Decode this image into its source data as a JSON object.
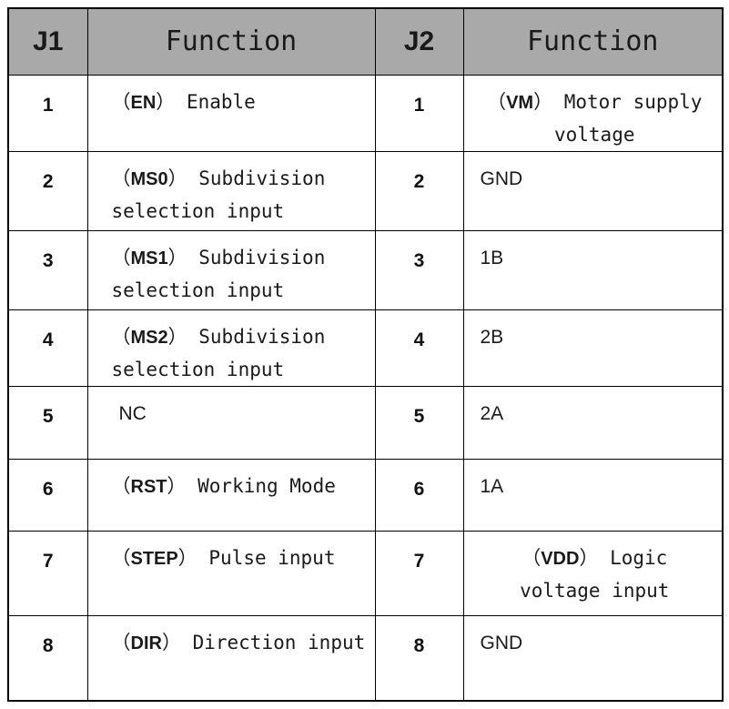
{
  "table": {
    "headers": [
      {
        "label": "J1",
        "kind": "num"
      },
      {
        "label": "Function",
        "kind": "text"
      },
      {
        "label": "J2",
        "kind": "num"
      },
      {
        "label": "Function",
        "kind": "text"
      }
    ],
    "rows": [
      {
        "j1_pin": "1",
        "j1_signal": "EN",
        "j1_desc": "Enable",
        "j2_pin": "1",
        "j2_signal": "VM",
        "j2_desc": "Motor supply voltage"
      },
      {
        "j1_pin": "2",
        "j1_signal": "MS0",
        "j1_desc": "Subdivision selection input",
        "j2_pin": "2",
        "j2_signal": "",
        "j2_desc": "GND"
      },
      {
        "j1_pin": "3",
        "j1_signal": "MS1",
        "j1_desc": "Subdivision selection input",
        "j2_pin": "3",
        "j2_signal": "",
        "j2_desc": "1B"
      },
      {
        "j1_pin": "4",
        "j1_signal": "MS2",
        "j1_desc": "Subdivision selection input",
        "j2_pin": "4",
        "j2_signal": "",
        "j2_desc": "2B"
      },
      {
        "j1_pin": "5",
        "j1_signal": "",
        "j1_desc": "NC",
        "j2_pin": "5",
        "j2_signal": "",
        "j2_desc": "2A"
      },
      {
        "j1_pin": "6",
        "j1_signal": "RST",
        "j1_desc": "Working Mode",
        "j2_pin": "6",
        "j2_signal": "",
        "j2_desc": "1A"
      },
      {
        "j1_pin": "7",
        "j1_signal": "STEP",
        "j1_desc": "Pulse input",
        "j2_pin": "7",
        "j2_signal": "VDD",
        "j2_desc": "Logic voltage input"
      },
      {
        "j1_pin": "8",
        "j1_signal": "DIR",
        "j1_desc": "Direction input",
        "j2_pin": "8",
        "j2_signal": "",
        "j2_desc": "GND"
      }
    ],
    "bracket_open": "（",
    "bracket_close": "）",
    "colors": {
      "header_background": "#a9a9a9",
      "border": "#000000",
      "cell_background": "#ffffff",
      "text": "#1a1a1a"
    }
  }
}
